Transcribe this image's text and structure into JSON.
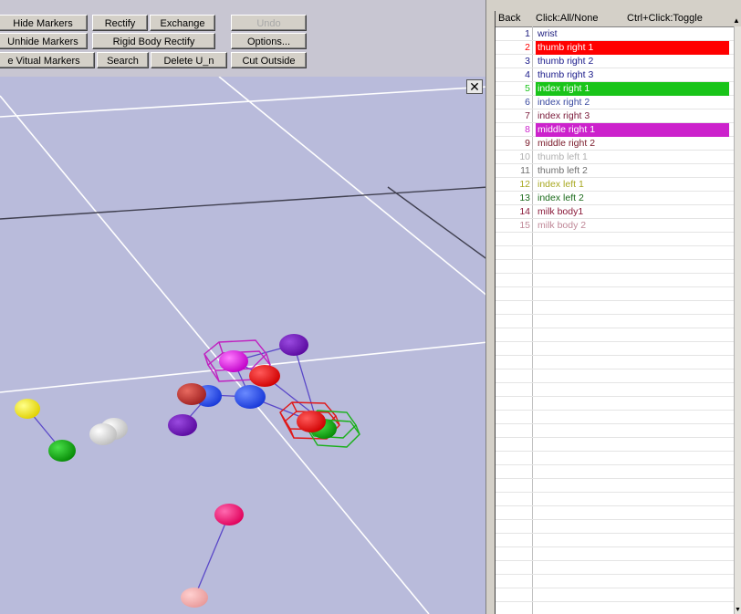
{
  "toolbar": {
    "hide_markers": "Hide Markers",
    "rectify": "Rectify",
    "exchange": "Exchange",
    "undo": "Undo",
    "unhide_markers": "Unhide Markers",
    "rigid_body_rectify": "Rigid Body Rectify",
    "options": "Options...",
    "virtual_markers": "e Vitual Markers",
    "search": "Search",
    "delete_un": "Delete U_n",
    "cut_outside": "Cut Outside"
  },
  "viewport": {
    "close_glyph": "✕"
  },
  "marker_panel": {
    "headers": {
      "back": "Back",
      "click_all_none": "Click:All/None",
      "ctrl_click_toggle": "Ctrl+Click:Toggle"
    },
    "scroll_up_glyph": "▲",
    "scroll_down_glyph": "▼",
    "markers": [
      {
        "num": "1",
        "label": "wrist",
        "color": "#202080",
        "highlight": null
      },
      {
        "num": "2",
        "label": "thumb right 1",
        "color": "#ffffff",
        "highlight": "#ff0000"
      },
      {
        "num": "3",
        "label": "thumb right 2",
        "color": "#1a1a8a",
        "highlight": null
      },
      {
        "num": "4",
        "label": "thumb right 3",
        "color": "#1a1a8a",
        "highlight": null
      },
      {
        "num": "5",
        "label": "index right 1",
        "color": "#ffffff",
        "highlight": "#19c419"
      },
      {
        "num": "6",
        "label": "index right 2",
        "color": "#3a4aa0",
        "highlight": null
      },
      {
        "num": "7",
        "label": "index right 3",
        "color": "#7a1a3a",
        "highlight": null
      },
      {
        "num": "8",
        "label": "middle right 1",
        "color": "#ffffff",
        "highlight": "#cc22cc"
      },
      {
        "num": "9",
        "label": "middle right 2",
        "color": "#7a1a2a",
        "highlight": null
      },
      {
        "num": "10",
        "label": "thumb left 1",
        "color": "#b0b0b0",
        "highlight": null
      },
      {
        "num": "11",
        "label": "thumb left 2",
        "color": "#707070",
        "highlight": null
      },
      {
        "num": "12",
        "label": "index left 1",
        "color": "#a8a820",
        "highlight": null
      },
      {
        "num": "13",
        "label": "index left 2",
        "color": "#1a6a1a",
        "highlight": null
      },
      {
        "num": "14",
        "label": "milk body1",
        "color": "#8a1a3a",
        "highlight": null
      },
      {
        "num": "15",
        "label": "milk body 2",
        "color": "#c08898",
        "highlight": null
      }
    ]
  }
}
